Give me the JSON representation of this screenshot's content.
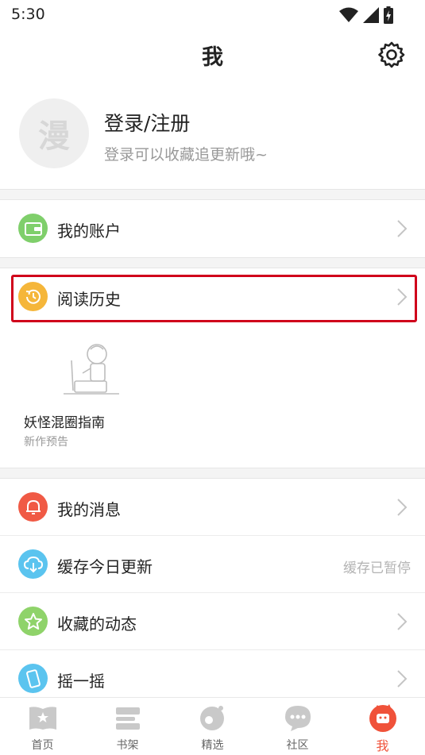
{
  "status_bar": {
    "time": "5:30"
  },
  "header": {
    "title": "我"
  },
  "profile": {
    "avatar_char": "漫",
    "name": "登录/注册",
    "subtitle": "登录可以收藏追更新哦~"
  },
  "account": {
    "label": "我的账户",
    "icon": "wallet-icon"
  },
  "history": {
    "label": "阅读历史",
    "icon": "clock-icon",
    "item": {
      "title": "妖怪混圈指南",
      "subtitle": "新作预告"
    }
  },
  "menu": {
    "messages": {
      "label": "我的消息",
      "icon": "bell-icon"
    },
    "cache": {
      "label": "缓存今日更新",
      "status": "缓存已暂停",
      "icon": "cloud-download-icon"
    },
    "favorites": {
      "label": "收藏的动态",
      "icon": "star-icon"
    },
    "shake": {
      "label": "摇一摇",
      "icon": "phone-shake-icon"
    }
  },
  "tabs": [
    {
      "label": "首页",
      "icon": "home-book-icon"
    },
    {
      "label": "书架",
      "icon": "bookshelf-icon"
    },
    {
      "label": "精选",
      "icon": "featured-icon"
    },
    {
      "label": "社区",
      "icon": "chat-bubble-icon"
    },
    {
      "label": "我",
      "icon": "profile-face-icon",
      "active": true
    }
  ],
  "colors": {
    "accent": "#f0523a",
    "highlight_border": "#d0021b",
    "account_icon": "#7fcf6b",
    "history_icon": "#f5b63a",
    "messages_icon": "#f05a45",
    "cache_icon": "#5bc4ef",
    "favorites_icon": "#8fd36a",
    "shake_icon": "#5bc4ef"
  }
}
